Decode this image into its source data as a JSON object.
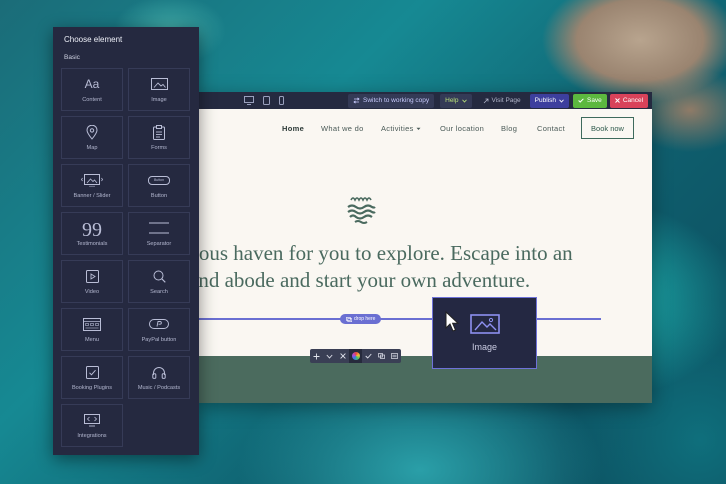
{
  "panel": {
    "title": "Choose element",
    "section": "Basic",
    "tiles": [
      {
        "label": "Content",
        "icon": "text-aa-icon"
      },
      {
        "label": "Image",
        "icon": "image-icon"
      },
      {
        "label": "Map",
        "icon": "map-pin-icon"
      },
      {
        "label": "Forms",
        "icon": "clipboard-icon"
      },
      {
        "label": "Banner / Slider",
        "icon": "banner-slider-icon"
      },
      {
        "label": "Button",
        "icon": "button-icon"
      },
      {
        "label": "Testimonials",
        "icon": "quote-icon"
      },
      {
        "label": "Separator",
        "icon": "separator-icon"
      },
      {
        "label": "Video",
        "icon": "video-icon"
      },
      {
        "label": "Search",
        "icon": "search-icon"
      },
      {
        "label": "Menu",
        "icon": "menu-icon"
      },
      {
        "label": "PayPal button",
        "icon": "paypal-icon"
      },
      {
        "label": "Booking Plugins",
        "icon": "calendar-check-icon"
      },
      {
        "label": "Music / Podcasts",
        "icon": "headphones-icon"
      },
      {
        "label": "Integrations",
        "icon": "integrations-icon"
      }
    ],
    "button_sample_text": "Button"
  },
  "toolbar": {
    "switch_label": "Switch to working copy",
    "help_label": "Help",
    "visit_label": "Visit Page",
    "publish_label": "Publish",
    "save_label": "Save",
    "cancel_label": "Cancel"
  },
  "site": {
    "nav": [
      "Home",
      "What we do",
      "Activities",
      "Our location",
      "Blog",
      "Contact"
    ],
    "book_label": "Book now",
    "hero_line1": "rious haven for you to explore. Escape into an",
    "hero_line2": "and abode and start your own adventure.",
    "drop_label": "drop here"
  },
  "drag": {
    "label": "Image"
  },
  "colors": {
    "panel_bg": "#252940",
    "accent": "#6a6fd2",
    "save": "#5cb83f",
    "cancel": "#d9425a",
    "publish": "#3d3f9e",
    "green_band": "#4b6b5e",
    "hero_text": "#4a6a5f"
  }
}
